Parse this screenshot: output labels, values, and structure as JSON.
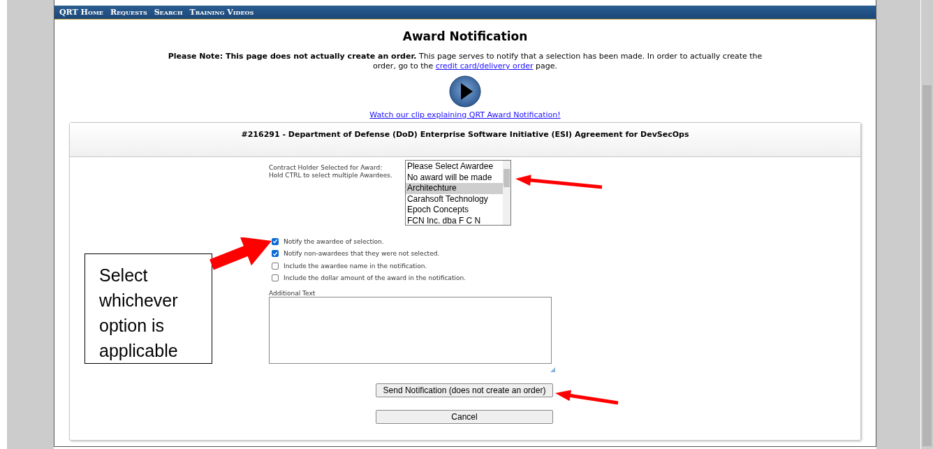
{
  "nav": [
    {
      "label": "QRT Home"
    },
    {
      "label": "Requests"
    },
    {
      "label": "Search"
    },
    {
      "label": "Training Videos"
    }
  ],
  "title": "Award Notification",
  "note": {
    "bold": "Please Note: This page does not actually create an order.",
    "text": " This page serves to notify that a selection has been made. In order to actually create the order, go to the ",
    "link": "credit card/delivery order",
    "after": " page."
  },
  "video_link": "Watch our clip explaining QRT Award Notification!",
  "card": {
    "title": "#216291 - Department of Defense (DoD) Enterprise Software Initiative (ESI) Agreement for DevSecOps",
    "awardee_label": [
      "Contract Holder Selected for Award:",
      "Hold CTRL to select multiple Awardees."
    ],
    "awardees": [
      {
        "label": "Please Select Awardee",
        "selected": false
      },
      {
        "label": "No award will be made",
        "selected": false
      },
      {
        "label": "Architechture",
        "selected": true
      },
      {
        "label": "Carahsoft Technology",
        "selected": false
      },
      {
        "label": "Epoch Concepts",
        "selected": false
      },
      {
        "label": "FCN Inc. dba F C N",
        "selected": false
      }
    ],
    "options": [
      {
        "label": "Notify the awardee of selection.",
        "checked": true
      },
      {
        "label": "Notify non-awardees that they were not selected.",
        "checked": true
      },
      {
        "label": "Include the awardee name in the notification.",
        "checked": false
      },
      {
        "label": "Include the dollar amount of the award in the notification.",
        "checked": false
      }
    ],
    "additional_text_label": "Additional Text",
    "buttons": [
      {
        "label": "Send Notification (does not create an order)"
      },
      {
        "label": "Cancel"
      }
    ]
  },
  "callout": "Select whichever option is applicable"
}
